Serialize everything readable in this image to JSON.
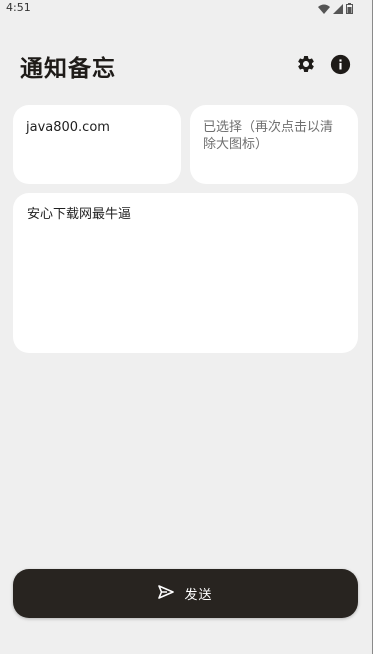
{
  "status_bar": {
    "time": "4:51",
    "icons": [
      "wifi-icon",
      "signal-icon",
      "battery-icon"
    ]
  },
  "header": {
    "title": "通知备忘",
    "icons": [
      "gear-icon",
      "info-icon"
    ]
  },
  "cards": {
    "title_value": "java800.com",
    "icon_value": "已选择（再次点击以清除大图标）",
    "content_value": "安心下载网最牛逼"
  },
  "send_button": {
    "label": "发送",
    "icon": "send-icon"
  },
  "colors": {
    "background": "#efefef",
    "card": "#ffffff",
    "button": "#282420",
    "title": "#1e1b18"
  }
}
